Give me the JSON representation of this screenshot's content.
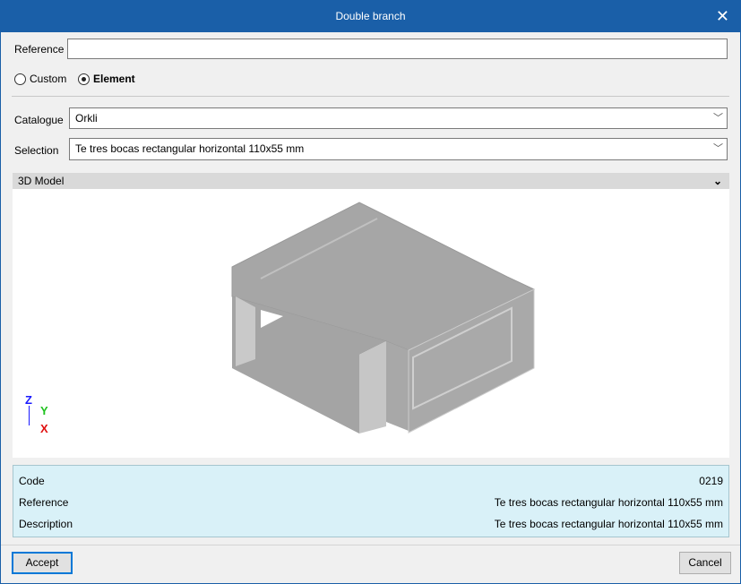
{
  "title": "Double branch",
  "reference": {
    "label": "Reference",
    "value": ""
  },
  "mode": {
    "options": [
      "Custom",
      "Element"
    ],
    "selected": "Element"
  },
  "catalogue": {
    "label": "Catalogue",
    "value": "Orkli"
  },
  "selection": {
    "label": "Selection",
    "value": "Te tres bocas rectangular horizontal 110x55 mm"
  },
  "model_section": {
    "label": "3D Model"
  },
  "axes": {
    "z": "Z",
    "y": "Y",
    "x": "X"
  },
  "info": {
    "rows": [
      {
        "label": "Code",
        "value": "0219"
      },
      {
        "label": "Reference",
        "value": "Te tres bocas rectangular horizontal 110x55 mm"
      },
      {
        "label": "Description",
        "value": "Te tres bocas rectangular horizontal 110x55 mm"
      }
    ]
  },
  "buttons": {
    "accept": "Accept",
    "cancel": "Cancel"
  },
  "colors": {
    "titlebar": "#1a5fa8",
    "info_bg": "#d9f1f8"
  }
}
